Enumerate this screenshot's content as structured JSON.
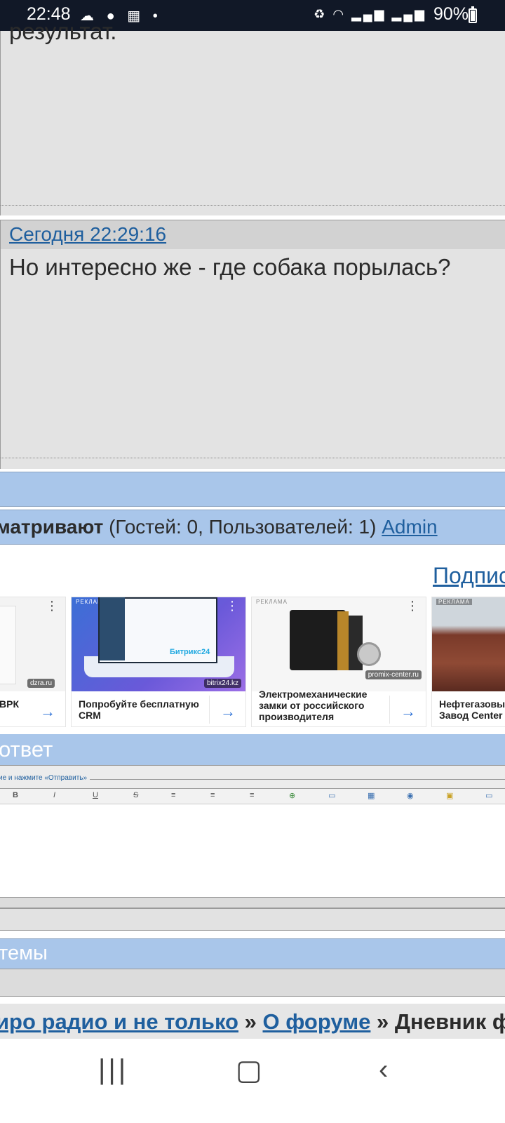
{
  "status_bar": {
    "time": "22:48",
    "battery": "90%",
    "left_icons": [
      "cloud-icon",
      "chat-icon",
      "calendar-icon",
      "dot-icon"
    ],
    "right_icons": [
      "battery-saver-icon",
      "wifi-icon",
      "signal-icon",
      "signal-icon"
    ]
  },
  "posts": [
    {
      "text": "результат."
    },
    {
      "date": "Сегодня 22:29:16",
      "text": "Но интересно же - где собака порылась?"
    }
  ],
  "viewers": {
    "lead": "матривают",
    "counts": "(Гостей: 0, Пользователей: 1)",
    "user": "Admin"
  },
  "subscribe": "Подпис",
  "ads": [
    {
      "title": "ВРК",
      "domain": "dzra.ru",
      "label": ""
    },
    {
      "title": "Попробуйте бесплатную CRM",
      "domain": "bitrix24.kz",
      "label": "РЕКЛАМА · 16+",
      "brand": "Битрикс24"
    },
    {
      "title": "Электромеханические замки от российского производителя",
      "domain": "promix-center.ru",
      "label": "РЕКЛАМА"
    },
    {
      "title": "Нефтегазовы Завод Center",
      "domain": "",
      "label": "РЕКЛАМА"
    }
  ],
  "reply": {
    "title": "ответ",
    "hint": "ие и нажмите «Отправить»",
    "toolbar": [
      "B",
      "I",
      "U",
      "S"
    ]
  },
  "topics_title": "темы",
  "breadcrumbs": {
    "item1": "иро радио и не только",
    "sep": "»",
    "item2": "О форуме",
    "current": "Дневник фор"
  },
  "colors": {
    "post_bg": "#e3e3e3",
    "bar_blue": "#a9c6ea",
    "link": "#1f5f9e",
    "statusbar": "#111827"
  }
}
